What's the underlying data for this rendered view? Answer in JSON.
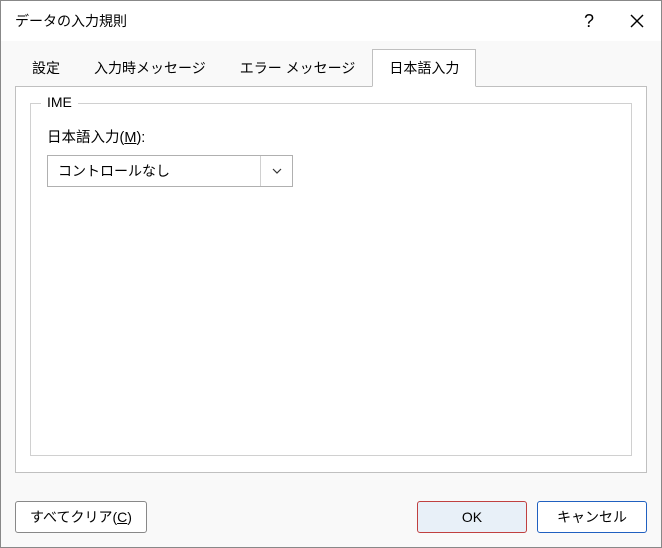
{
  "titlebar": {
    "title": "データの入力規則"
  },
  "tabs": {
    "t0": "設定",
    "t1": "入力時メッセージ",
    "t2": "エラー メッセージ",
    "t3": "日本語入力"
  },
  "ime_group": {
    "legend": "IME",
    "field_label_pre": "日本語入力(",
    "field_label_accel": "M",
    "field_label_post": "):",
    "select_value": "コントロールなし"
  },
  "footer": {
    "clear_pre": "すべてクリア(",
    "clear_accel": "C",
    "clear_post": ")",
    "ok": "OK",
    "cancel": "キャンセル"
  }
}
